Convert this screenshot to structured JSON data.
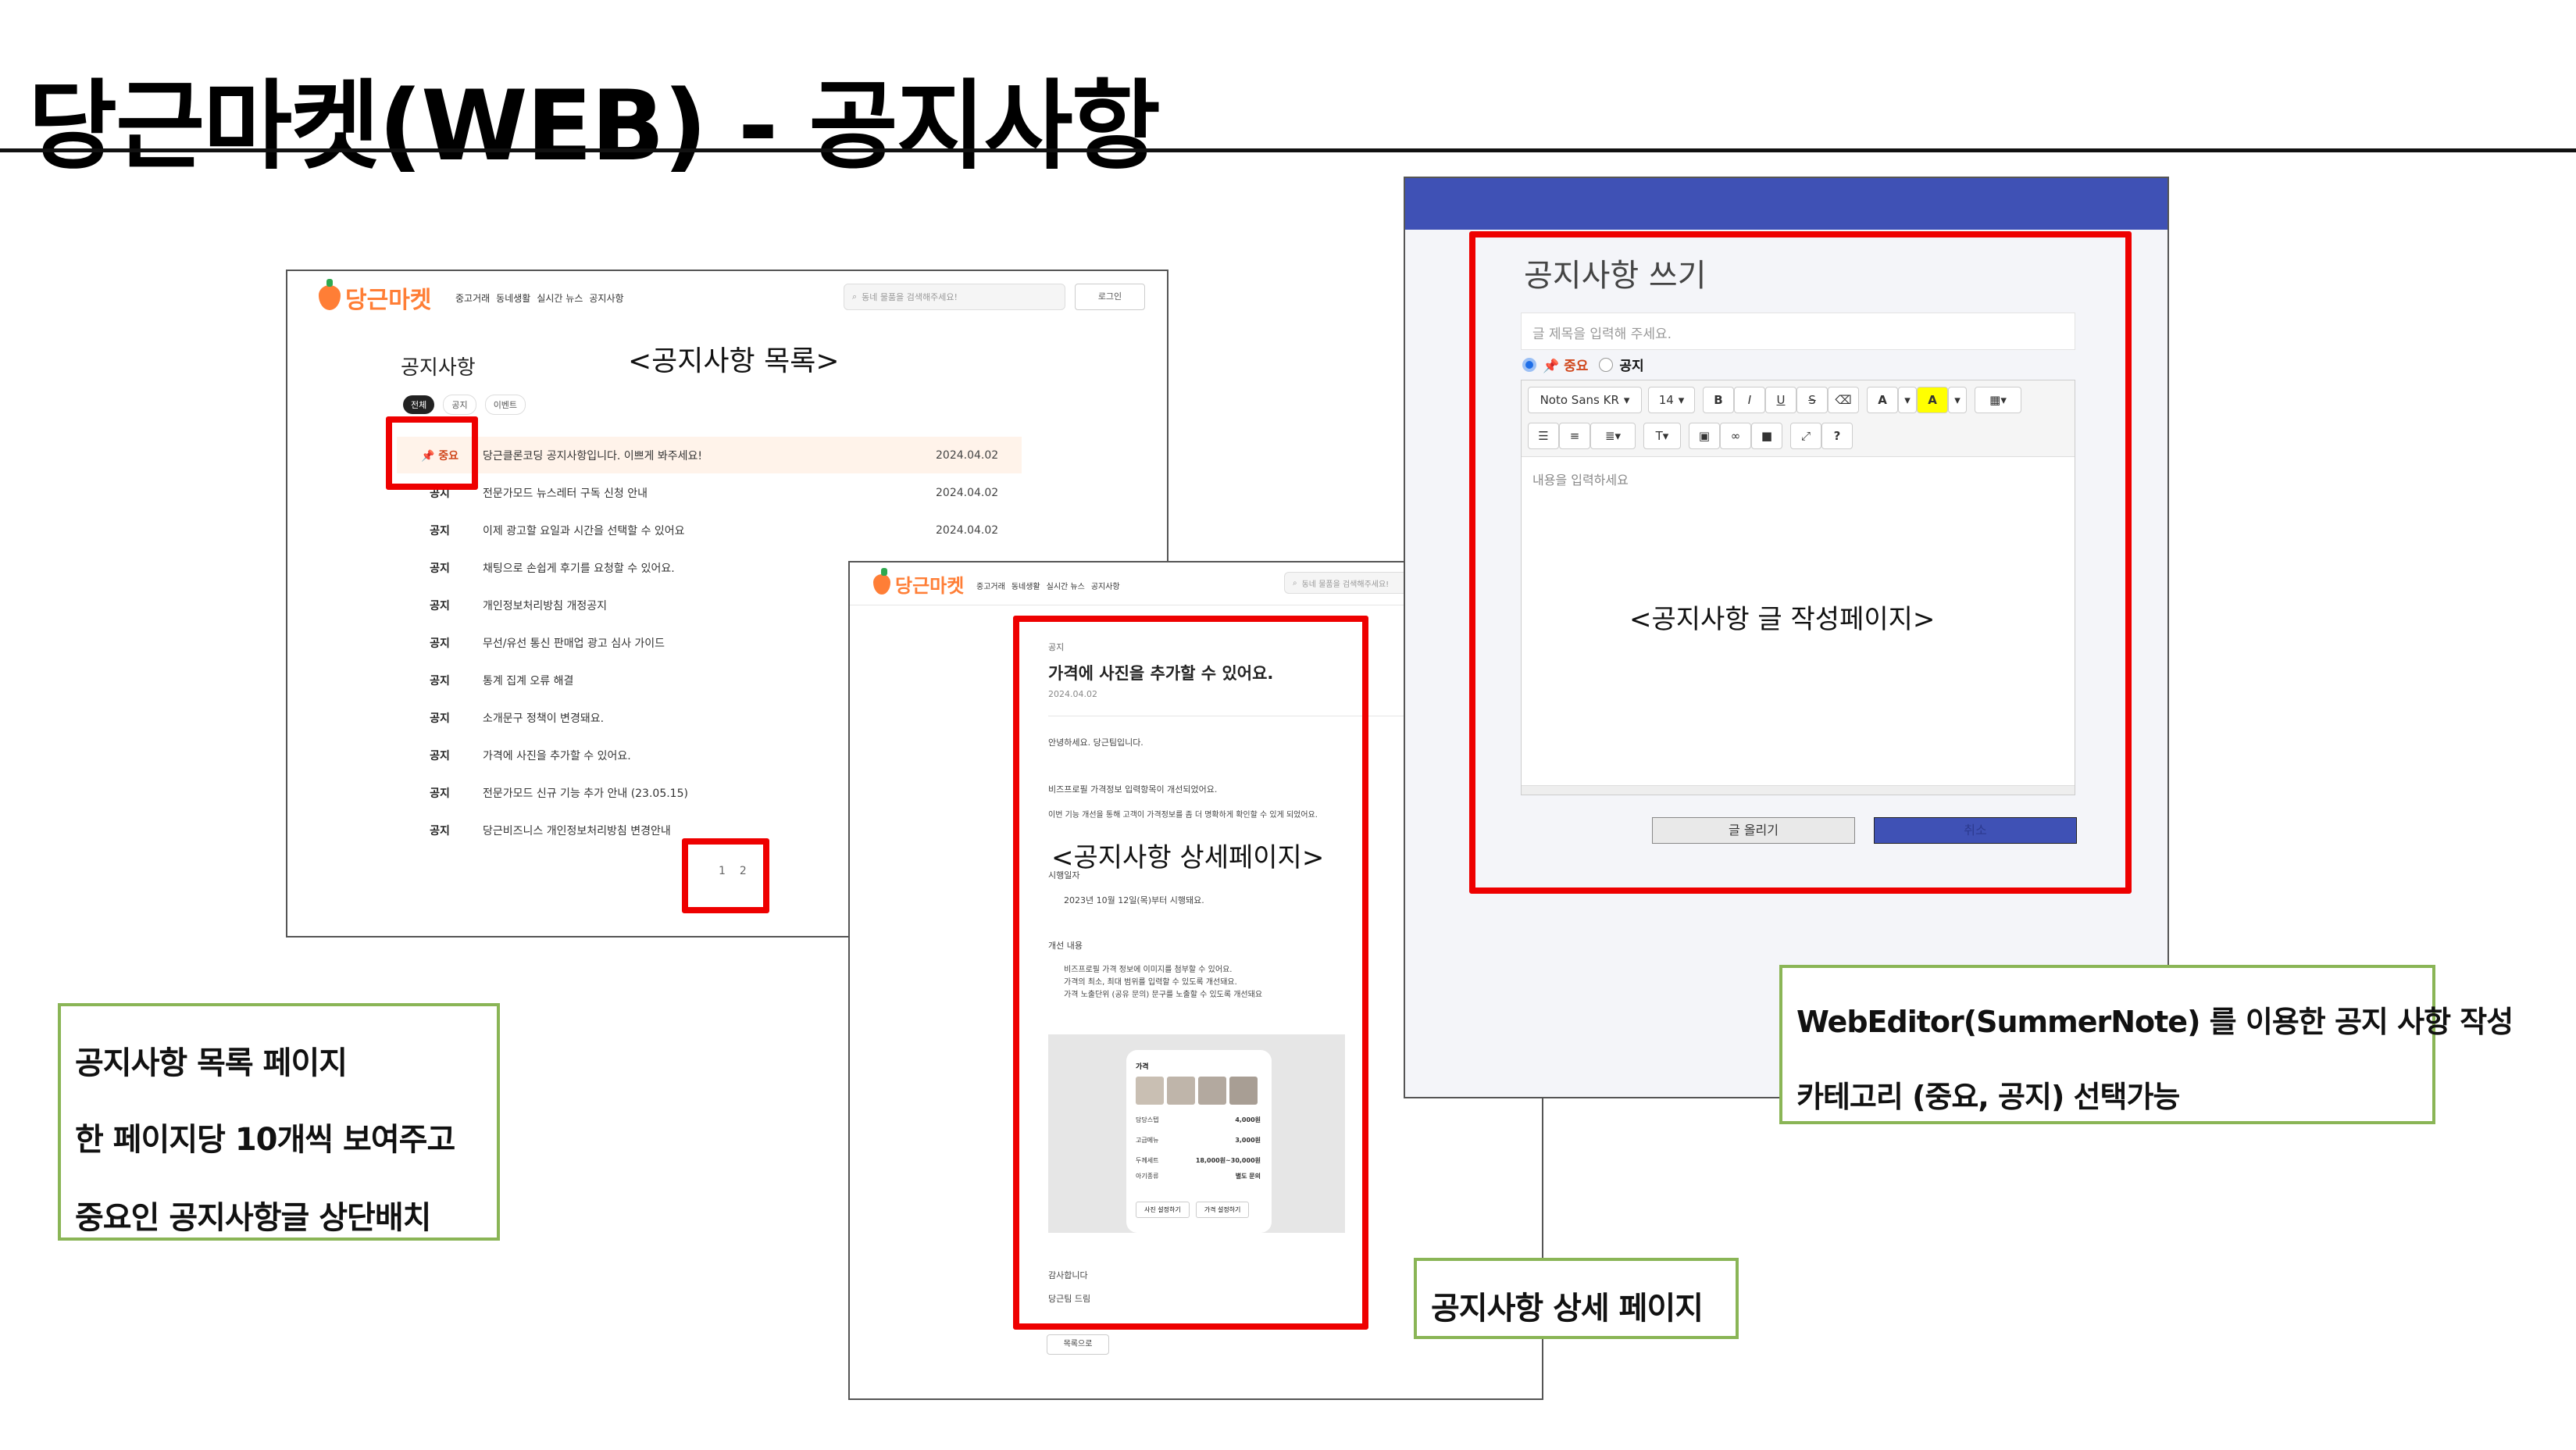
{
  "slide": {
    "title": "당근마켓(WEB) - 공지사항"
  },
  "list_page": {
    "logo": "당근마켓",
    "nav": [
      "중고거래",
      "동네생활",
      "실시간 뉴스",
      "공지사항"
    ],
    "search_placeholder": "동네 물품을 검색해주세요!",
    "login": "로그인",
    "heading": "공지사항",
    "annotation": "<공지사항 목록>",
    "tabs": [
      "전체",
      "공지",
      "이벤트"
    ],
    "rows": [
      {
        "category": "📌 중요",
        "title": "당근클론코딩 공지사항입니다. 이쁘게 봐주세요!",
        "date": "2024.04.02"
      },
      {
        "category": "공지",
        "title": "전문가모드 뉴스레터 구독 신청 안내",
        "date": "2024.04.02"
      },
      {
        "category": "공지",
        "title": "이제 광고할 요일과 시간을 선택할 수 있어요",
        "date": "2024.04.02"
      },
      {
        "category": "공지",
        "title": "채팅으로 손쉽게 후기를 요청할 수 있어요.",
        "date": ""
      },
      {
        "category": "공지",
        "title": "개인정보처리방침 개정공지",
        "date": ""
      },
      {
        "category": "공지",
        "title": "무선/유선 통신 판매업 광고 심사 가이드",
        "date": ""
      },
      {
        "category": "공지",
        "title": "통계 집계 오류 해결",
        "date": ""
      },
      {
        "category": "공지",
        "title": "소개문구 정책이 변경돼요.",
        "date": ""
      },
      {
        "category": "공지",
        "title": "가격에 사진을 추가할 수 있어요.",
        "date": ""
      },
      {
        "category": "공지",
        "title": "전문가모드 신규 기능 추가 안내 (23.05.15)",
        "date": ""
      },
      {
        "category": "공지",
        "title": "당근비즈니스 개인정보처리방침 변경안내",
        "date": ""
      }
    ],
    "pages": [
      "1",
      "2"
    ]
  },
  "detail_page": {
    "logo": "당근마켓",
    "nav": [
      "중고거래",
      "동네생활",
      "실시간 뉴스",
      "공지사항"
    ],
    "search_placeholder": "동네 물품을 검색해주세요!",
    "category": "공지",
    "title": "가격에 사진을 추가할 수 있어요.",
    "date": "2024.04.02",
    "greeting": "안녕하세요. 당근팀입니다.",
    "body1": "비즈프로필 가격정보 입력항목이 개선되었어요.",
    "body2": "이번 기능 개선을 통해 고객이 가격정보를 좀 더 명확하게 확인할 수 있게 되었어요.",
    "annotation": "<공지사항 상세페이지>",
    "section1": "시행일자",
    "section1_text": "2023년 10월 12일(목)부터 시행돼요.",
    "section2": "개선 내용",
    "section2_lines": [
      "비즈프로필 가격 정보에 이미지를 첨부할 수 있어요.",
      "가격의 최소, 최대 범위를 입력할 수 있도록 개선돼요.",
      "가격 노출단위 (공유 문의) 문구를 노출할 수 있도록 개선돼요"
    ],
    "mock_label": "가격",
    "mock_rows": [
      {
        "name": "담당스텝",
        "price": "4,000원"
      },
      {
        "name": "고급메뉴",
        "price": "3,000원"
      },
      {
        "name": "두께세트",
        "price": "18,000원~30,000원"
      },
      {
        "name": "아기종류",
        "price": "별도 문의"
      }
    ],
    "mock_buttons": [
      "사진 설정하기",
      "가격 설정하기"
    ],
    "thanks": "감사합니다",
    "sign": "당근팀 드림",
    "back": "목록으로"
  },
  "editor_page": {
    "heading": "공지사항 쓰기",
    "title_placeholder": "글 제목을 입력해 주세요.",
    "radio_important": "📌 중요",
    "radio_notice": "공지",
    "font": "Noto Sans KR",
    "size": "14",
    "body_placeholder": "내용을 입력하세요",
    "annotation": "<공지사항 글 작성페이지>",
    "submit": "글 올리기",
    "cancel": "취소"
  },
  "callouts": {
    "list": [
      "공지사항 목록 페이지",
      "한 페이지당 10개씩 보여주고",
      "중요인 공지사항글 상단배치"
    ],
    "detail": "공지사항 상세 페이지",
    "editor": [
      "WebEditor(SummerNote) 를 이용한 공지 사항 작성",
      "카테고리 (중요, 공지) 선택가능"
    ]
  },
  "colors": {
    "accent_orange": "#ff7e36",
    "highlight_red": "#e00000",
    "callout_green": "#8ab556",
    "editor_header_blue": "#3f51b5"
  }
}
